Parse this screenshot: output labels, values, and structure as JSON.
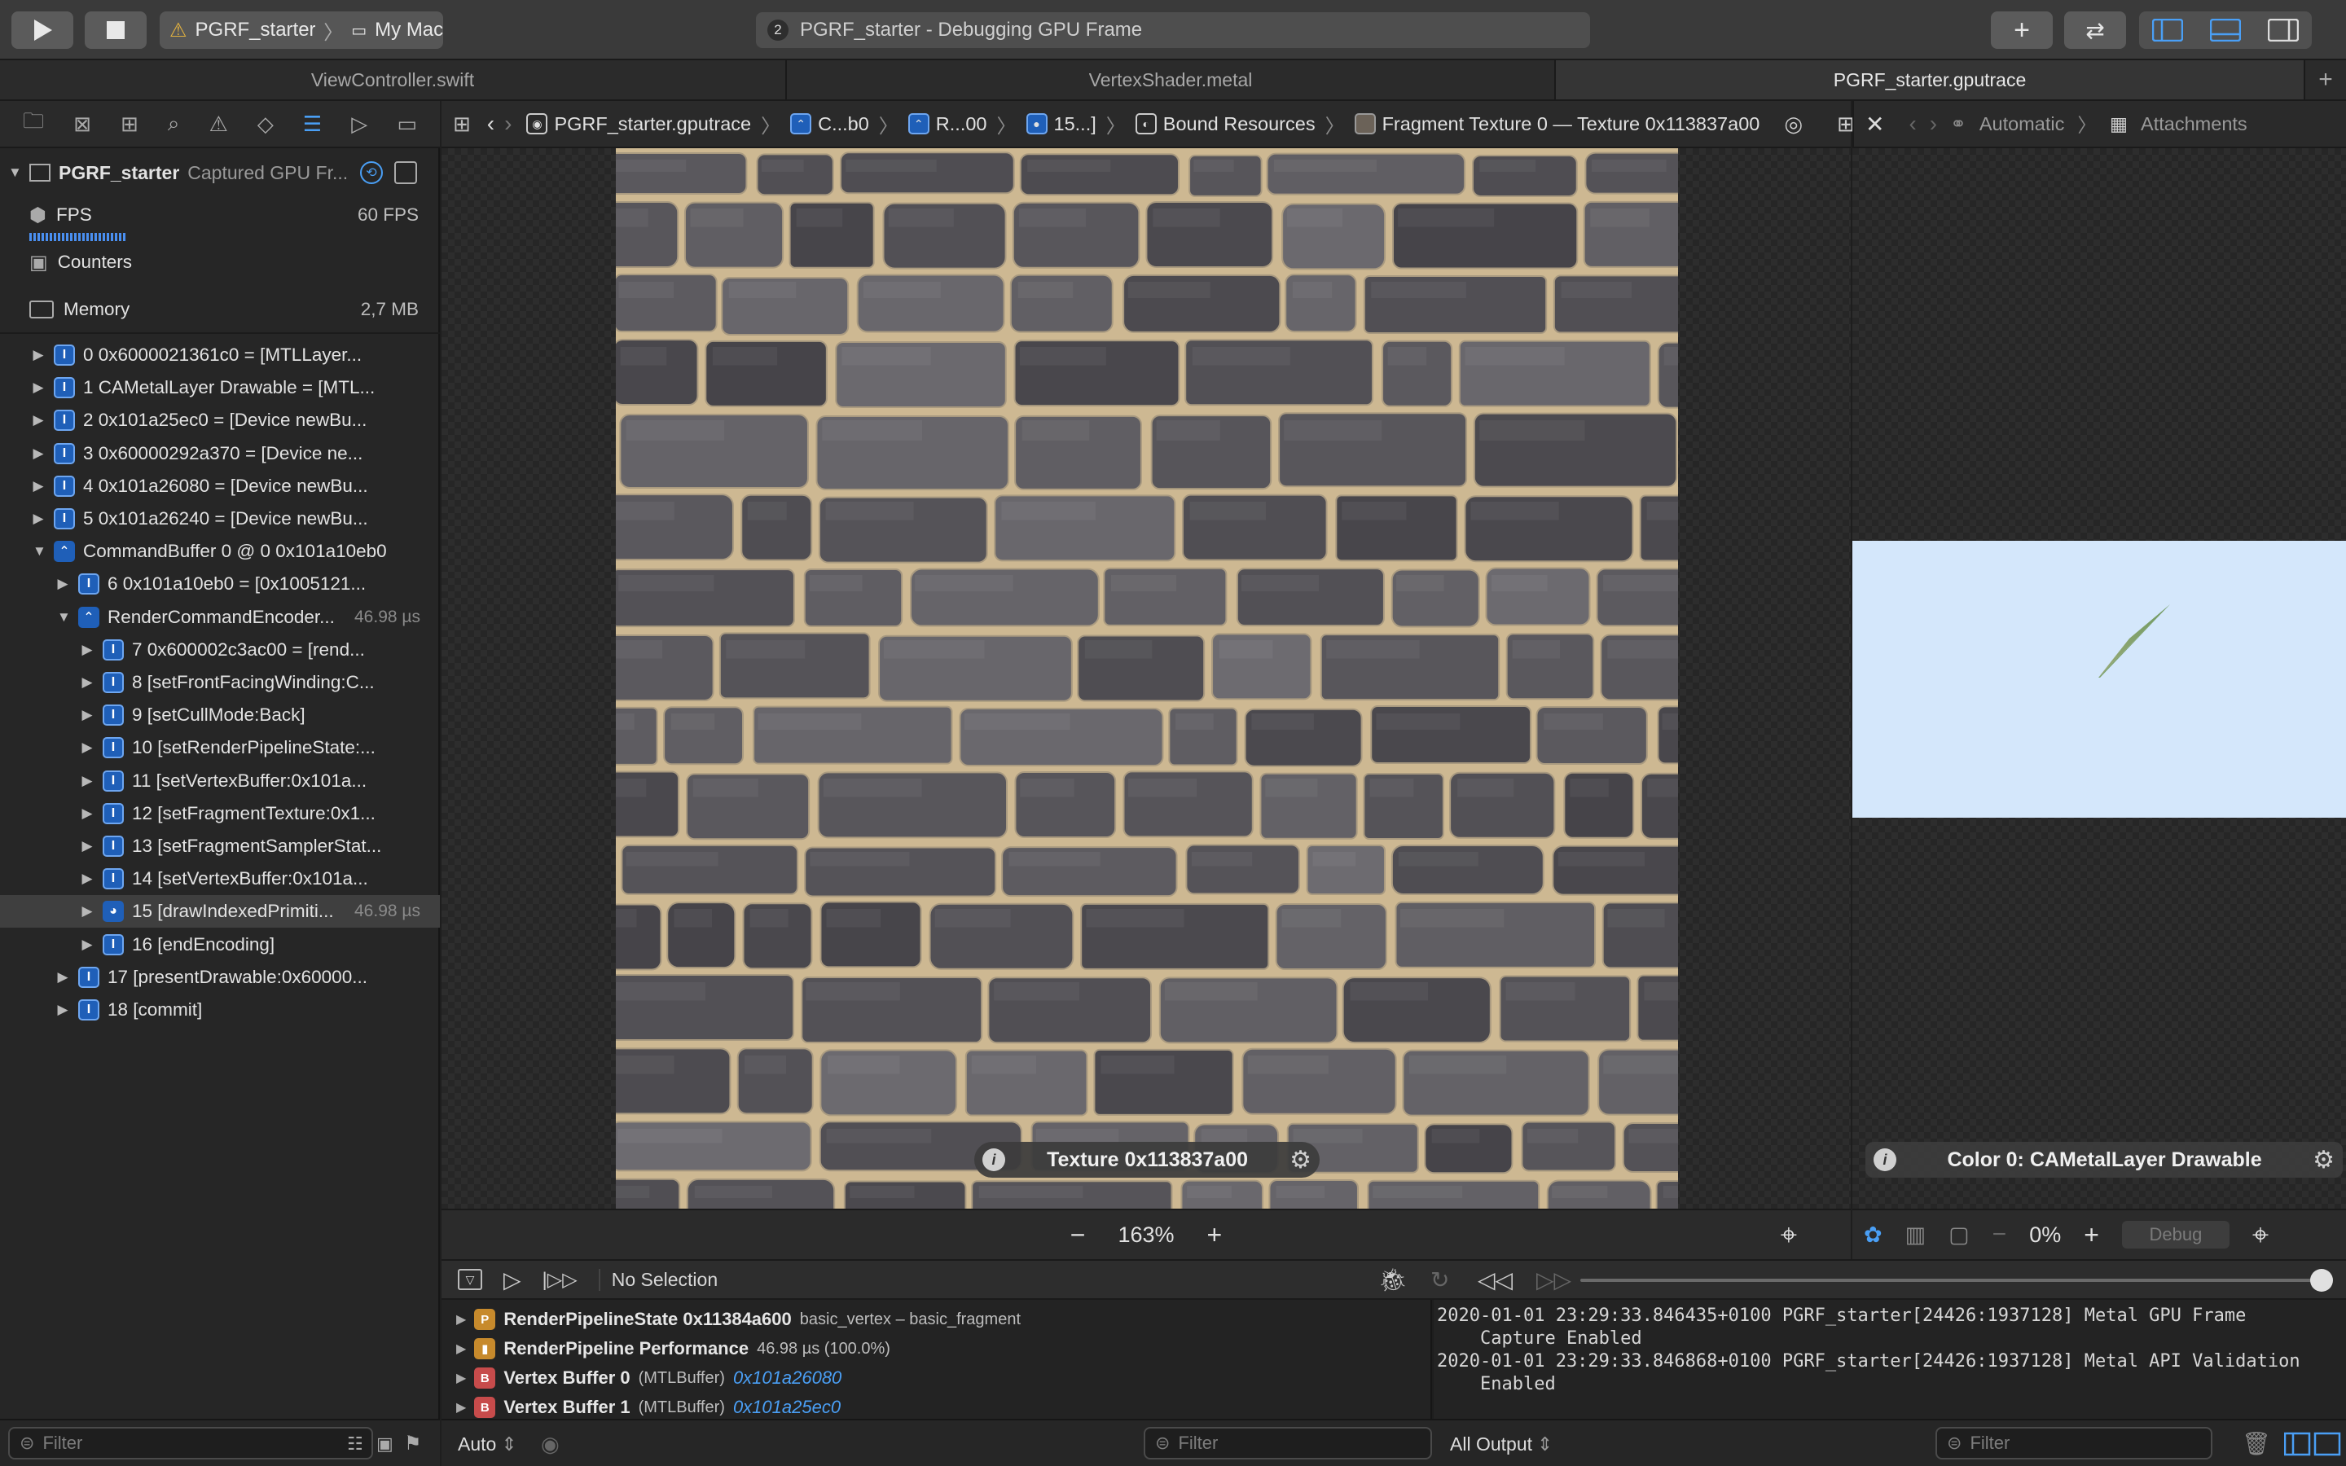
{
  "toolbar": {
    "scheme_target": "PGRF_starter",
    "scheme_device": "My Mac",
    "activity_badge": "2",
    "activity_text": "PGRF_starter - Debugging GPU Frame"
  },
  "tabs": [
    "ViewController.swift",
    "VertexShader.metal",
    "PGRF_starter.gputrace"
  ],
  "navigator": {
    "title": "PGRF_starter",
    "subtitle": "Captured GPU Fr...",
    "fps_label": "FPS",
    "fps_value": "60 FPS",
    "counters_label": "Counters",
    "memory_label": "Memory",
    "memory_value": "2,7 MB",
    "commands": [
      {
        "text": "0 0x6000021361c0 = [MTLLayer...",
        "level": 0,
        "expanded": false,
        "icon": "I",
        "dur": ""
      },
      {
        "text": "1 CAMetalLayer Drawable = [MTL...",
        "level": 0,
        "expanded": false,
        "icon": "I",
        "dur": ""
      },
      {
        "text": "2 0x101a25ec0 = [Device newBu...",
        "level": 0,
        "expanded": false,
        "icon": "I",
        "dur": ""
      },
      {
        "text": "3 0x60000292a370 = [Device ne...",
        "level": 0,
        "expanded": false,
        "icon": "I",
        "dur": ""
      },
      {
        "text": "4 0x101a26080 = [Device newBu...",
        "level": 0,
        "expanded": false,
        "icon": "I",
        "dur": ""
      },
      {
        "text": "5 0x101a26240 = [Device newBu...",
        "level": 0,
        "expanded": false,
        "icon": "I",
        "dur": ""
      },
      {
        "text": "CommandBuffer 0 @ 0 0x101a10eb0",
        "level": 0,
        "expanded": true,
        "icon": "CB",
        "dur": ""
      },
      {
        "text": "6 0x101a10eb0 = [0x1005121...",
        "level": 1,
        "expanded": false,
        "icon": "I",
        "dur": ""
      },
      {
        "text": "RenderCommandEncoder...",
        "level": 1,
        "expanded": true,
        "icon": "RE",
        "dur": "46.98 µs"
      },
      {
        "text": "7 0x600002c3ac00 = [rend...",
        "level": 2,
        "expanded": false,
        "icon": "I",
        "dur": ""
      },
      {
        "text": "8 [setFrontFacingWinding:C...",
        "level": 2,
        "expanded": false,
        "icon": "I",
        "dur": ""
      },
      {
        "text": "9 [setCullMode:Back]",
        "level": 2,
        "expanded": false,
        "icon": "I",
        "dur": ""
      },
      {
        "text": "10 [setRenderPipelineState:...",
        "level": 2,
        "expanded": false,
        "icon": "I",
        "dur": ""
      },
      {
        "text": "11 [setVertexBuffer:0x101a...",
        "level": 2,
        "expanded": false,
        "icon": "I",
        "dur": ""
      },
      {
        "text": "12 [setFragmentTexture:0x1...",
        "level": 2,
        "expanded": false,
        "icon": "I",
        "dur": ""
      },
      {
        "text": "13 [setFragmentSamplerStat...",
        "level": 2,
        "expanded": false,
        "icon": "I",
        "dur": ""
      },
      {
        "text": "14 [setVertexBuffer:0x101a...",
        "level": 2,
        "expanded": false,
        "icon": "I",
        "dur": ""
      },
      {
        "text": "15 [drawIndexedPrimiti...",
        "level": 2,
        "expanded": false,
        "icon": "DRAW",
        "dur": "46.98 µs",
        "selected": true
      },
      {
        "text": "16 [endEncoding]",
        "level": 2,
        "expanded": false,
        "icon": "I",
        "dur": ""
      },
      {
        "text": "17 [presentDrawable:0x60000...",
        "level": 1,
        "expanded": false,
        "icon": "I",
        "dur": ""
      },
      {
        "text": "18 [commit]",
        "level": 1,
        "expanded": false,
        "icon": "I",
        "dur": ""
      }
    ],
    "filter_placeholder": "Filter"
  },
  "jumpbar": {
    "file": "PGRF_starter.gputrace",
    "c1": "C...b0",
    "c2": "R...00",
    "c3": "15...]",
    "c4": "Bound Resources",
    "c5": "Fragment Texture 0 — Texture 0x113837a00"
  },
  "viewer": {
    "texture_label": "Texture 0x113837a00",
    "zoom": "163%"
  },
  "assistant": {
    "mode": "Automatic",
    "section": "Attachments",
    "attachment_label": "Color 0: CAMetalLayer Drawable",
    "zoom": "0%",
    "debug_label": "Debug"
  },
  "debugbar": {
    "selection": "No Selection"
  },
  "variables": [
    {
      "badge": "P",
      "badge_color": "#c78a2c",
      "name": "RenderPipelineState 0x11384a600",
      "type": "basic_vertex – basic_fragment",
      "addr": ""
    },
    {
      "badge": "perf",
      "badge_color": "#c78a2c",
      "name": "RenderPipeline Performance",
      "type": "46.98 µs (100.0%)",
      "addr": ""
    },
    {
      "badge": "B",
      "badge_color": "#c74b4b",
      "name": "Vertex Buffer 0",
      "type": "(MTLBuffer)",
      "addr": "0x101a26080"
    },
    {
      "badge": "B",
      "badge_color": "#c74b4b",
      "name": "Vertex Buffer 1",
      "type": "(MTLBuffer)",
      "addr": "0x101a25ec0"
    }
  ],
  "console": {
    "text": "2020-01-01 23:29:33.846435+0100 PGRF_starter[24426:1937128] Metal GPU Frame\n    Capture Enabled\n2020-01-01 23:29:33.846868+0100 PGRF_starter[24426:1937128] Metal API Validation\n    Enabled"
  },
  "footer": {
    "auto_label": "Auto",
    "vars_filter": "Filter",
    "output_label": "All Output",
    "console_filter": "Filter"
  },
  "colors": {
    "accent": "#1f5fb8",
    "attachment_bg": "#d4e7fb"
  }
}
